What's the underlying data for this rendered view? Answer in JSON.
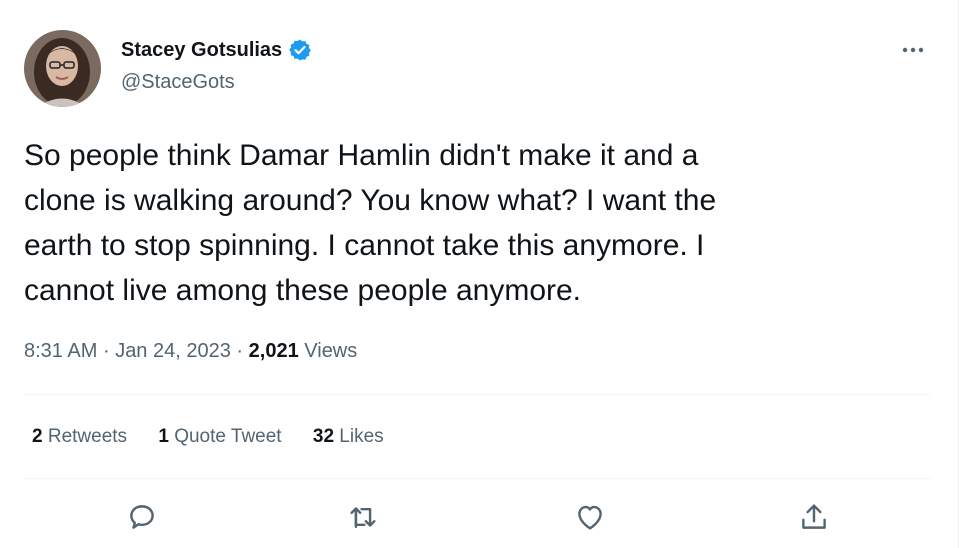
{
  "author": {
    "display_name": "Stacey Gotsulias",
    "handle": "@StaceGots",
    "verified_icon": "verified-badge-icon"
  },
  "tweet": {
    "lines": [
      "So people think Damar Hamlin didn't make it and a",
      "clone is walking around? You know what? I want the",
      "earth to stop spinning. I cannot take this anymore. I",
      "cannot live among these people anymore."
    ],
    "time": "8:31 AM",
    "separator": "·",
    "date": "Jan 24, 2023",
    "views_count": "2,021",
    "views_label": "Views"
  },
  "stats": {
    "retweets_count": "2",
    "retweets_label": "Retweets",
    "quotes_count": "1",
    "quotes_label": "Quote Tweet",
    "likes_count": "32",
    "likes_label": "Likes"
  },
  "actions": [
    "reply-icon",
    "retweet-icon",
    "like-icon",
    "share-icon"
  ],
  "colors": {
    "text_primary": "#0f1419",
    "text_secondary": "#536471",
    "verified_blue": "#1d9bf0",
    "divider": "#eff3f4"
  }
}
